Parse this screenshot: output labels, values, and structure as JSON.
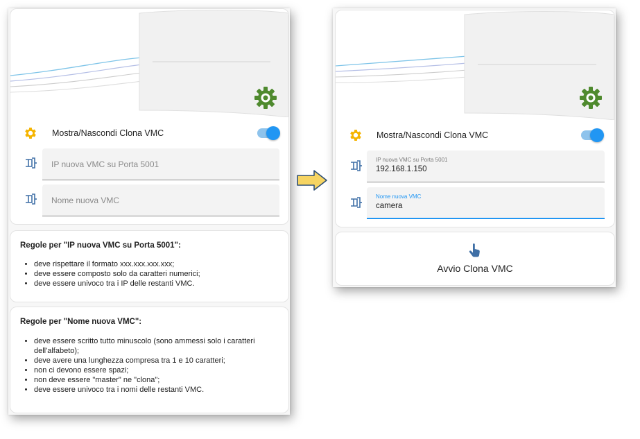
{
  "colors": {
    "accent": "#2196f3",
    "gear_icon": "#f5b400",
    "device_icon": "#3f6fa6",
    "logo_green": "#4f8a2e",
    "arrow_fill": "#f6d462"
  },
  "before": {
    "toggle_label": "Mostra/Nascondi Clona VMC",
    "toggle_on": true,
    "ip_field": {
      "placeholder": "IP nuova VMC su Porta 5001"
    },
    "name_field": {
      "placeholder": "Nome nuova VMC"
    }
  },
  "rules_ip": {
    "title": "Regole per \"IP nuova VMC su Porta 5001\":",
    "items": [
      "deve rispettare il formato xxx.xxx.xxx.xxx;",
      "deve essere composto solo da caratteri numerici;",
      "deve essere univoco tra i IP delle restanti VMC."
    ]
  },
  "rules_name": {
    "title": "Regole per \"Nome nuova VMC\":",
    "items": [
      "deve essere scritto tutto minuscolo (sono ammessi solo i caratteri dell'alfabeto);",
      "deve avere una lunghezza compresa tra 1 e 10 caratteri;",
      "non ci devono essere spazi;",
      "non deve essere \"master\" ne \"clona\";",
      "deve essere univoco tra i nomi delle restanti VMC."
    ]
  },
  "after": {
    "toggle_label": "Mostra/Nascondi Clona VMC",
    "toggle_on": true,
    "ip_field": {
      "label": "IP nuova VMC su Porta 5001",
      "value": "192.168.1.150"
    },
    "name_field": {
      "label": "Nome nuova VMC",
      "value": "camera"
    },
    "action_button": {
      "label": "Avvio Clona VMC",
      "icon": "hand-pointer-icon"
    }
  }
}
